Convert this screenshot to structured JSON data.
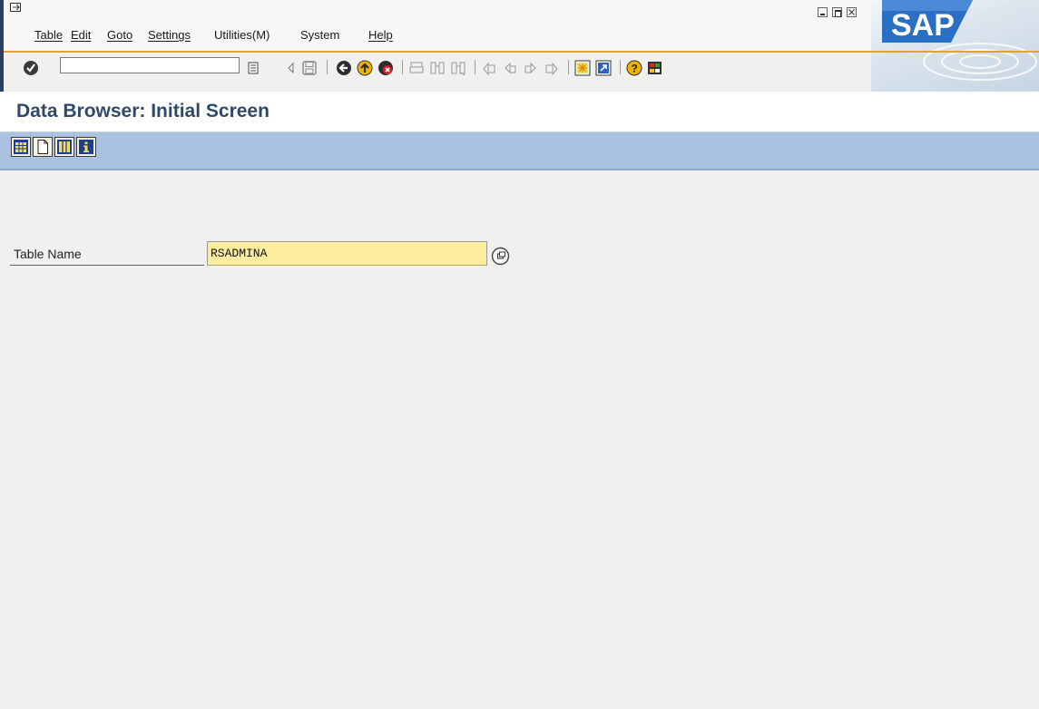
{
  "menubar": {
    "items": [
      {
        "key": "table",
        "first": "T",
        "rest": "able"
      },
      {
        "key": "edit",
        "first": "E",
        "rest": "dit"
      },
      {
        "key": "goto",
        "first": "G",
        "rest": "oto"
      },
      {
        "key": "settings",
        "first": "S",
        "rest": "ettings"
      },
      {
        "key": "utilities",
        "label": "Utilities(M)"
      },
      {
        "key": "system",
        "label": "System"
      },
      {
        "key": "help",
        "first": "H",
        "rest": "elp"
      }
    ]
  },
  "brand": {
    "logo_text": "SAP"
  },
  "command_field": {
    "value": ""
  },
  "title": "Data Browser: Initial Screen",
  "form": {
    "table_name": {
      "label": "Table Name",
      "value": "RSADMINA"
    }
  },
  "colors": {
    "title_text": "#2f4a68",
    "app_toolbar": "#a8c2e0",
    "input_highlight": "#fcec9e",
    "accent_line": "#e2a136"
  }
}
